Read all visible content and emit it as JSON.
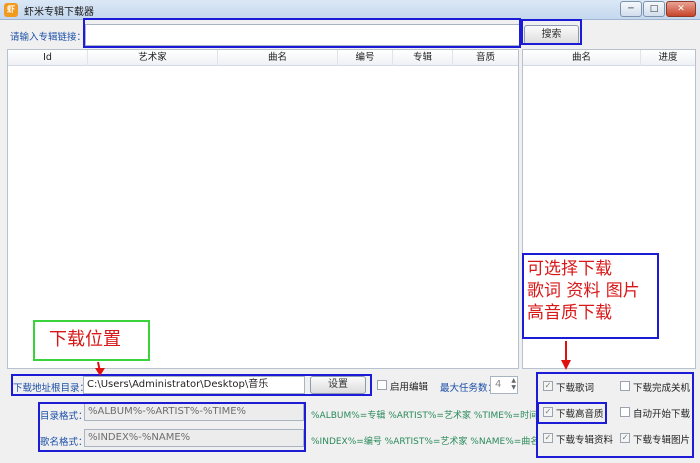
{
  "window": {
    "title": "虾米专辑下载器",
    "icon_glyph": "虾",
    "min_glyph": "─",
    "max_glyph": "□",
    "close_glyph": "✕"
  },
  "search": {
    "label": "请输入专辑链接：",
    "value": "",
    "button": "搜索"
  },
  "main_table": {
    "columns": [
      "Id",
      "艺术家",
      "曲名",
      "编号",
      "专辑",
      "音质"
    ]
  },
  "progress_table": {
    "columns": [
      "曲名",
      "进度"
    ]
  },
  "download": {
    "path_label": "下载地址根目录：",
    "path_value": "C:\\Users\\Administrator\\Desktop\\音乐",
    "set_button": "设置",
    "enable_edit_label": "启用编辑",
    "max_tasks_label": "最大任务数：",
    "max_tasks_value": "4"
  },
  "formats": {
    "dir_label": "目录格式：",
    "dir_value": "%ALBUM%-%ARTIST%-%TIME%",
    "dir_hint": "%ALBUM%=专辑 %ARTIST%=艺术家 %TIME%=时间",
    "name_label": "歌名格式：",
    "name_value": "%INDEX%-%NAME%",
    "name_hint": "%INDEX%=编号 %ARTIST%=艺术家 %NAME%=曲名"
  },
  "options": [
    {
      "label": "下载歌词",
      "checked": true
    },
    {
      "label": "下载完成关机",
      "checked": false
    },
    {
      "label": "下载高音质",
      "checked": true
    },
    {
      "label": "自动开始下载",
      "checked": false
    },
    {
      "label": "下载专辑资料",
      "checked": true
    },
    {
      "label": "下载专辑图片",
      "checked": true
    }
  ],
  "annotations": {
    "options_note": [
      "可选择下载",
      "歌词 资料 图片",
      "高音质下载"
    ],
    "location_note": "下载位置"
  },
  "colors": {
    "annotation_border": "#1c1cd6",
    "annotation_text": "#d81818",
    "location_border": "#3bd33b",
    "arrow": "#e01010",
    "label_blue": "#1b4fa8",
    "hint_green": "#2a8a5a"
  }
}
